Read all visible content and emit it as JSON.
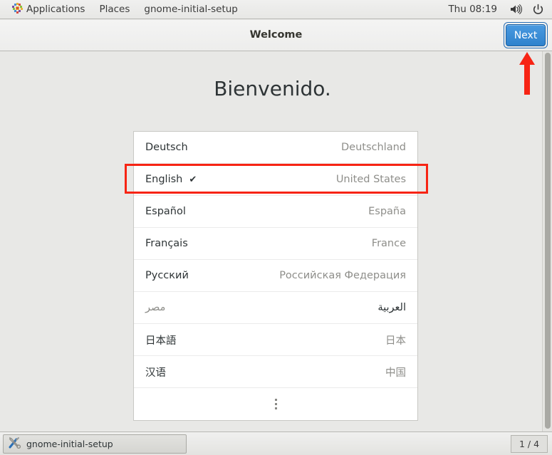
{
  "top_panel": {
    "apps_icon": "applications-pinwheel-icon",
    "applications_label": "Applications",
    "places_label": "Places",
    "window_menu_label": "gnome-initial-setup",
    "clock": "Thu 08:19",
    "volume_icon": "speaker-volume-icon",
    "power_icon": "power-icon"
  },
  "headerbar": {
    "title": "Welcome",
    "next_label": "Next"
  },
  "content": {
    "greeting": "Bienvenido."
  },
  "language_list": {
    "selected_index": 1,
    "check_glyph": "✔",
    "rows": [
      {
        "name": "Deutsch",
        "country": "Deutschland",
        "rtl": false,
        "selected": false
      },
      {
        "name": "English",
        "country": "United States",
        "rtl": false,
        "selected": true
      },
      {
        "name": "Español",
        "country": "España",
        "rtl": false,
        "selected": false
      },
      {
        "name": "Français",
        "country": "France",
        "rtl": false,
        "selected": false
      },
      {
        "name": "Русский",
        "country": "Российская Федерация",
        "rtl": false,
        "selected": false
      },
      {
        "name": "العربية",
        "country": "مصر",
        "rtl": true,
        "selected": false
      },
      {
        "name": "日本語",
        "country": "日本",
        "rtl": false,
        "selected": false
      },
      {
        "name": "汉语",
        "country": "中国",
        "rtl": false,
        "selected": false
      }
    ],
    "more_row": {
      "icon": "more-vertical-dots-icon"
    }
  },
  "annotations": {
    "highlight_box_target": "english-language-row",
    "arrow_target": "next-button",
    "color": "#f72414"
  },
  "taskbar": {
    "task_icon": "tools-screwdriver-wrench-icon",
    "task_label": "gnome-initial-setup",
    "workspace_indicator": "1 / 4"
  },
  "scrollbar": {
    "orientation": "vertical"
  },
  "colors": {
    "accent_blue": "#3184ce",
    "annotation_red": "#f72414",
    "panel_bg": "#ededeb",
    "content_bg": "#e8e8e6",
    "list_bg": "#ffffff",
    "secondary_text": "#8e8e8a"
  }
}
